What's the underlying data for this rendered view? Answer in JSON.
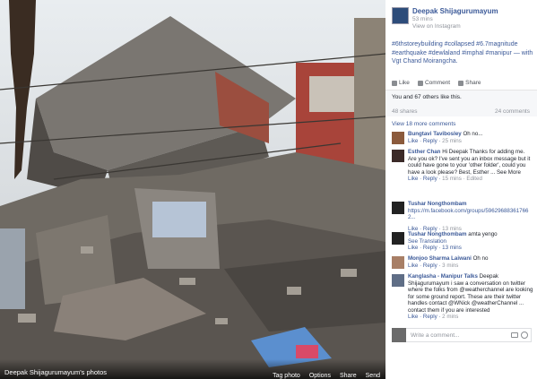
{
  "photo": {
    "owner_caption": "Deepak Shijagurumayum's photos",
    "actions": [
      "Tag photo",
      "Options",
      "Share",
      "Send"
    ]
  },
  "post": {
    "poster": "Deepak Shijagurumayum",
    "time": "53 mins",
    "via": "View on Instagram",
    "text_tags": "#6thstoreybuilding #collapsed #6.7magnitude #earthquake #dewlaland #imphal #manipur — with",
    "with_name": "Vgt Chand Moirangcha.",
    "actions": [
      "Like",
      "Comment",
      "Share"
    ],
    "likes": "You and 67 others like this.",
    "shares": "48 shares",
    "comments_count": "24 comments",
    "view_more": "View 18 more comments"
  },
  "comments": [
    {
      "name": "Bungtavi Tavibosley",
      "text": "Oh no...",
      "meta_actions": "Like · Reply",
      "time": "25 mins"
    },
    {
      "name": "Esther Chan",
      "text": "Hi Deepak Thanks for adding me. Are you ok? I've sent you an inbox message but it could have gone to your 'other folder', could you have a look please? Best, Esther ... See More",
      "meta_actions": "Like · Reply",
      "time": "15 mins · Edited"
    },
    {
      "name": "Tushar Nongthombam",
      "text": "https://m.facebook.com/groups/596296883617662...",
      "meta_actions": "Like · Reply",
      "time": "13 mins"
    },
    {
      "name": "Tushar Nongthombam",
      "text": "amta yengo",
      "meta_actions": "See Translation",
      "time": "Like · Reply · 13 mins"
    },
    {
      "name": "Monjoo Sharma Laiwani",
      "text": "Oh no",
      "meta_actions": "Like · Reply",
      "time": "3 mins"
    },
    {
      "name": "Kanglasha - Manipur Talks",
      "text": "Deepak Shijagurumayum i saw a conversation on twitter where the folks from @weatherchannel are looking for some ground report. These are their twitter handles contact @WNick @weatherChannel ... contact them if you are interested",
      "meta_actions": "Like · Reply",
      "time": "2 mins"
    }
  ],
  "write_placeholder": "Write a comment..."
}
